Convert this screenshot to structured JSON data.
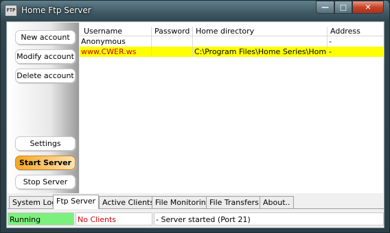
{
  "window": {
    "title": "Home Ftp Server",
    "icon_text": "FTP",
    "controls": {
      "minimize": "minimize-icon",
      "maximize": "maximize-icon",
      "close": "close-icon"
    }
  },
  "sidebar": {
    "new_account": "New account",
    "modify_account": "Modify account",
    "delete_account": "Delete account",
    "settings": "Settings",
    "start_server": "Start Server",
    "stop_server": "Stop Server"
  },
  "table": {
    "columns": [
      "Username",
      "Password",
      "Home directory",
      "Address"
    ],
    "rows": [
      {
        "username": "Anonymous",
        "password": "",
        "home": "",
        "address": "-"
      },
      {
        "username": "www.CWER.ws",
        "password": "",
        "home": "C:\\Program Files\\Home Series\\Home Ftp",
        "address": "-"
      }
    ]
  },
  "tabs": [
    "System Log",
    "Ftp Server",
    "Active Clients",
    "File Monitoring",
    "File Transfers",
    "About.."
  ],
  "active_tab": "Ftp Server",
  "status": {
    "state": "Running",
    "clients": "No Clients",
    "message": "- Server started (Port 21)"
  },
  "colors": {
    "running_bg": "#7cf07c",
    "highlight_row": "#ffff00",
    "start_button": "#f5a623",
    "error_text": "#cc0000"
  }
}
